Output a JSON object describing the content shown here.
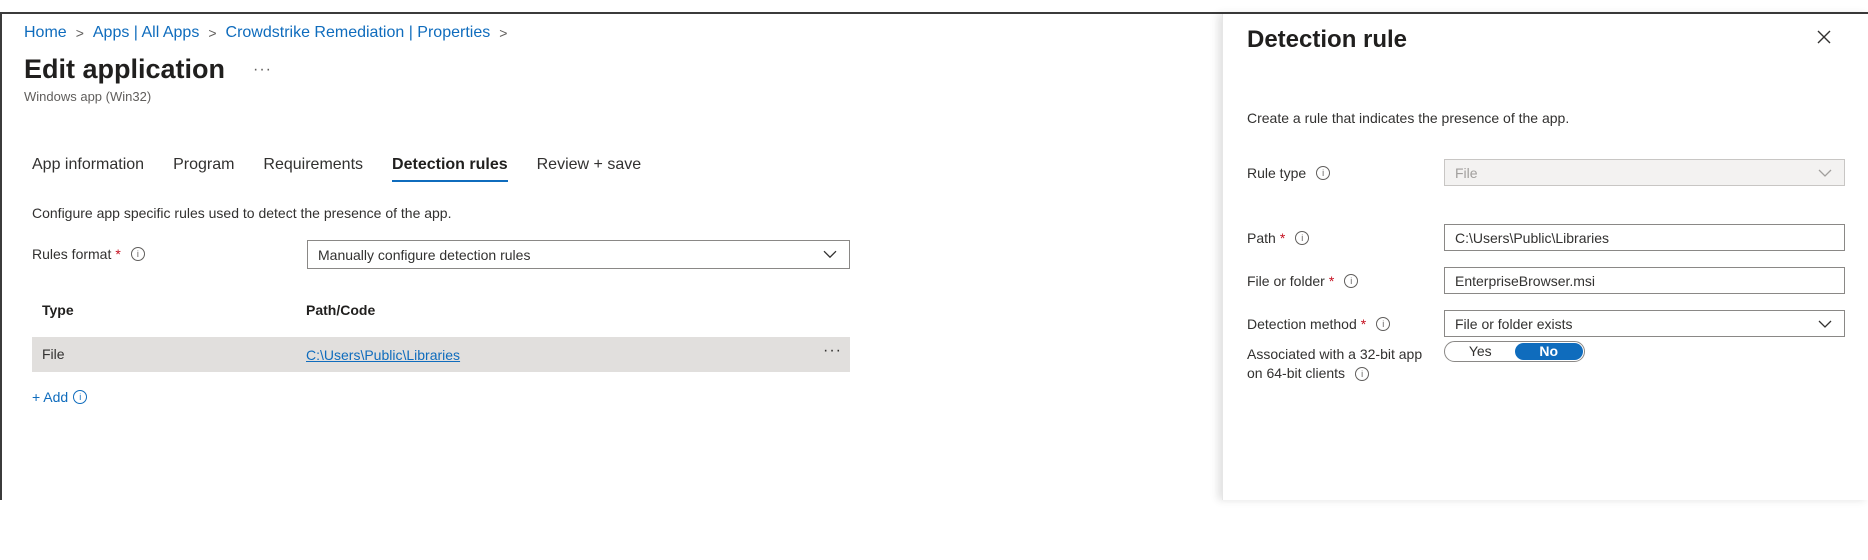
{
  "breadcrumb": [
    "Home",
    "Apps | All Apps",
    "Crowdstrike Remediation | Properties"
  ],
  "page": {
    "title": "Edit application",
    "more": "···",
    "subtitle": "Windows app (Win32)"
  },
  "tabs": [
    {
      "label": "App information",
      "active": false
    },
    {
      "label": "Program",
      "active": false
    },
    {
      "label": "Requirements",
      "active": false
    },
    {
      "label": "Detection rules",
      "active": true
    },
    {
      "label": "Review + save",
      "active": false
    }
  ],
  "detection": {
    "description": "Configure app specific rules used to detect the presence of the app.",
    "rules_format_label": "Rules format",
    "rules_format_value": "Manually configure detection rules",
    "table": {
      "headers": [
        "Type",
        "Path/Code"
      ],
      "rows": [
        {
          "type": "File",
          "path": "C:\\Users\\Public\\Libraries",
          "more": "···"
        }
      ]
    },
    "add_label": "+ Add"
  },
  "panel": {
    "title": "Detection rule",
    "description": "Create a rule that indicates the presence of the app.",
    "rule_type_label": "Rule type",
    "rule_type_value": "File",
    "path_label": "Path",
    "path_value": "C:\\Users\\Public\\Libraries",
    "file_label": "File or folder",
    "file_value": "EnterpriseBrowser.msi",
    "method_label": "Detection method",
    "method_value": "File or folder exists",
    "assoc_line1": "Associated with a 32-bit app",
    "assoc_line2": "on 64-bit clients",
    "toggle_yes": "Yes",
    "toggle_no": "No",
    "toggle_selected": "No"
  },
  "colors": {
    "accent": "#0f6cbd",
    "required": "#c50f1f",
    "row_selected": "#e1dfdd"
  }
}
